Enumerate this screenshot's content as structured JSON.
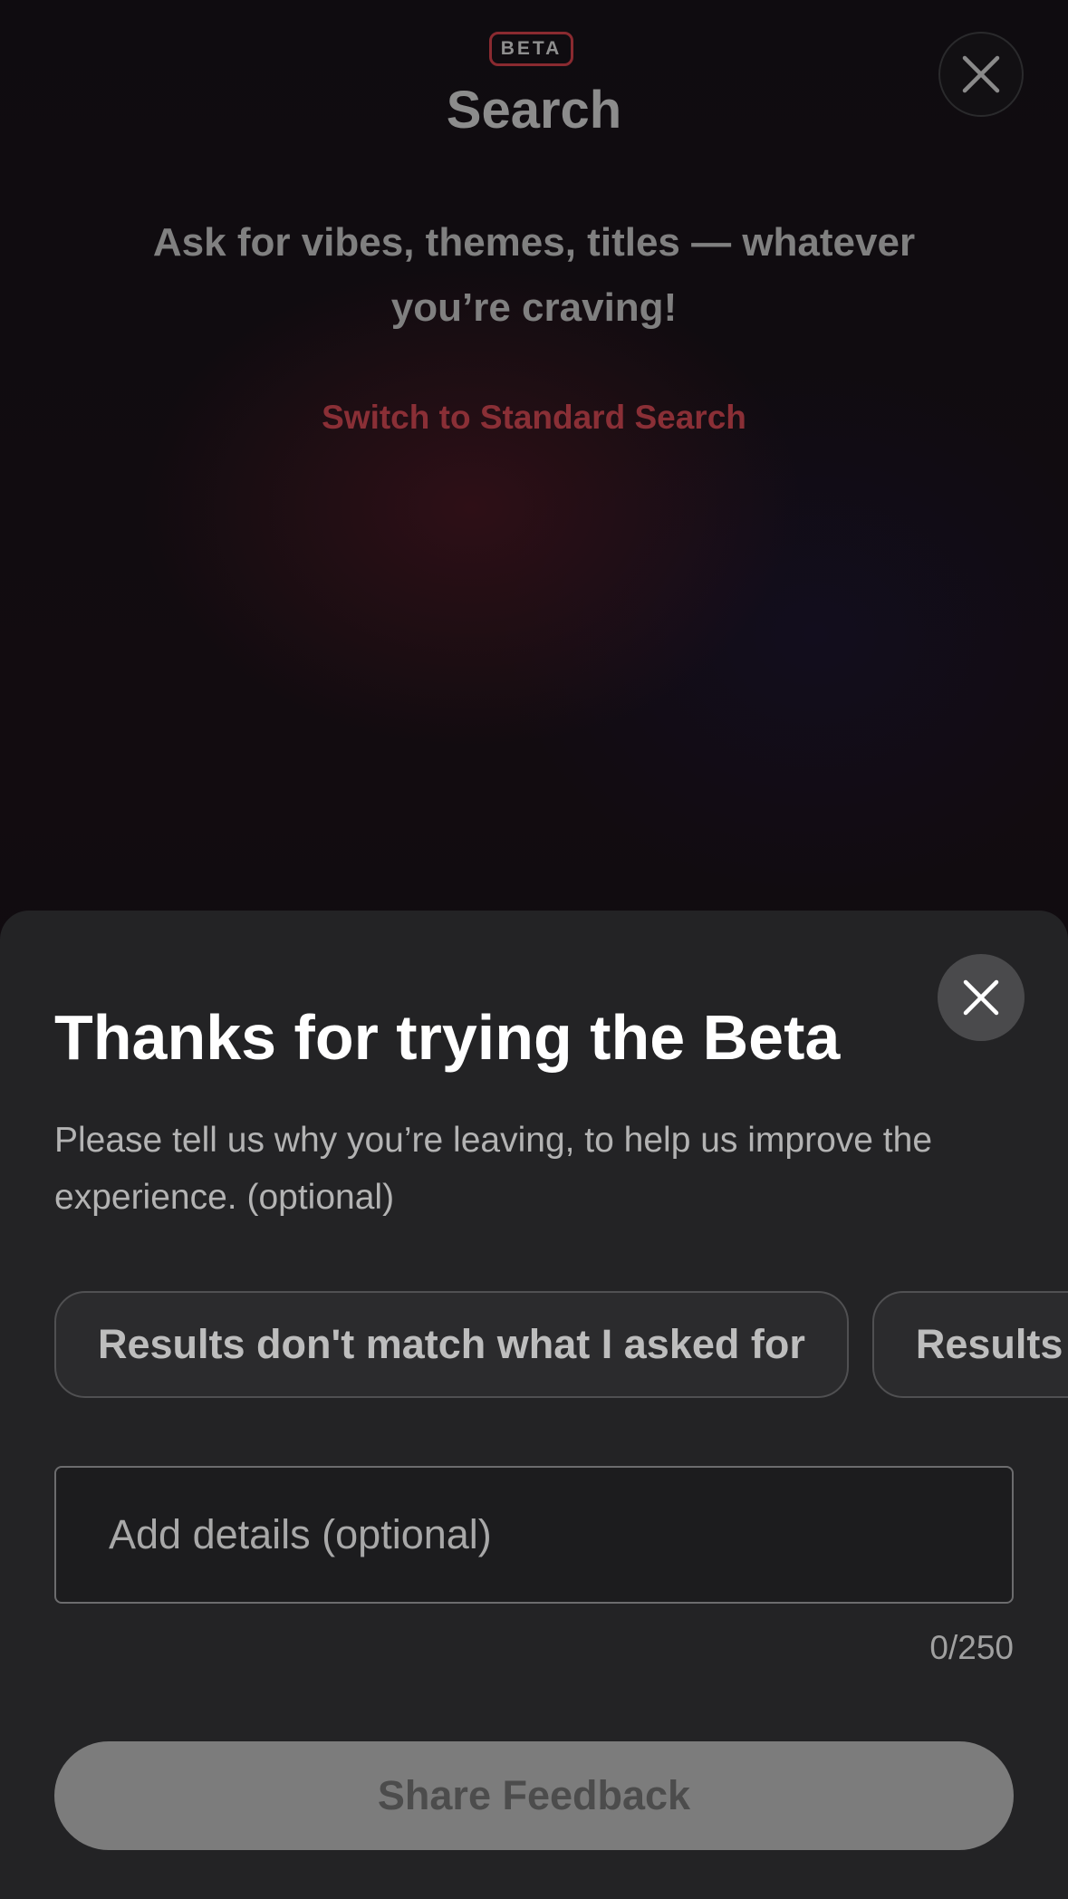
{
  "background_page": {
    "badge": "BETA",
    "title": "Search",
    "subtitle": "Ask for vibes, themes, titles — whatever you’re craving!",
    "switch_link": "Switch to Standard Search",
    "accent_color": "#8a2a30"
  },
  "feedback_sheet": {
    "title": "Thanks for trying the Beta",
    "description": "Please tell us why you’re leaving, to help us improve the experience. (optional)",
    "chips": [
      {
        "label": "Results don't match what I asked for"
      },
      {
        "label": "Results"
      }
    ],
    "details_placeholder": "Add details (optional)",
    "details_value": "",
    "char_count": "0/250",
    "submit_label": "Share Feedback"
  },
  "icons": {
    "top_close": "close-icon",
    "sheet_close": "close-icon"
  }
}
